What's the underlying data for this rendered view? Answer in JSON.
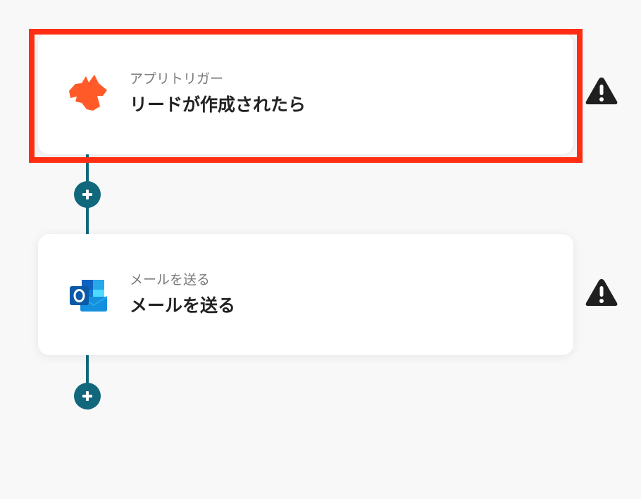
{
  "flow": {
    "steps": [
      {
        "kind_label": "アプリトリガー",
        "title": "リードが作成されたら",
        "icon": "fox-icon",
        "icon_color": "#ff5a28",
        "status_icon": "warning-icon",
        "highlighted": true
      },
      {
        "kind_label": "メールを送る",
        "title": "メールを送る",
        "icon": "outlook-icon",
        "icon_color": "#0f63c0",
        "status_icon": "warning-icon",
        "highlighted": false
      }
    ],
    "add_step_icon": "plus-icon"
  },
  "colors": {
    "background": "#f8f8f8",
    "connector": "#11677c",
    "highlight": "#ff2d12",
    "warning": "#1f1f1f"
  }
}
